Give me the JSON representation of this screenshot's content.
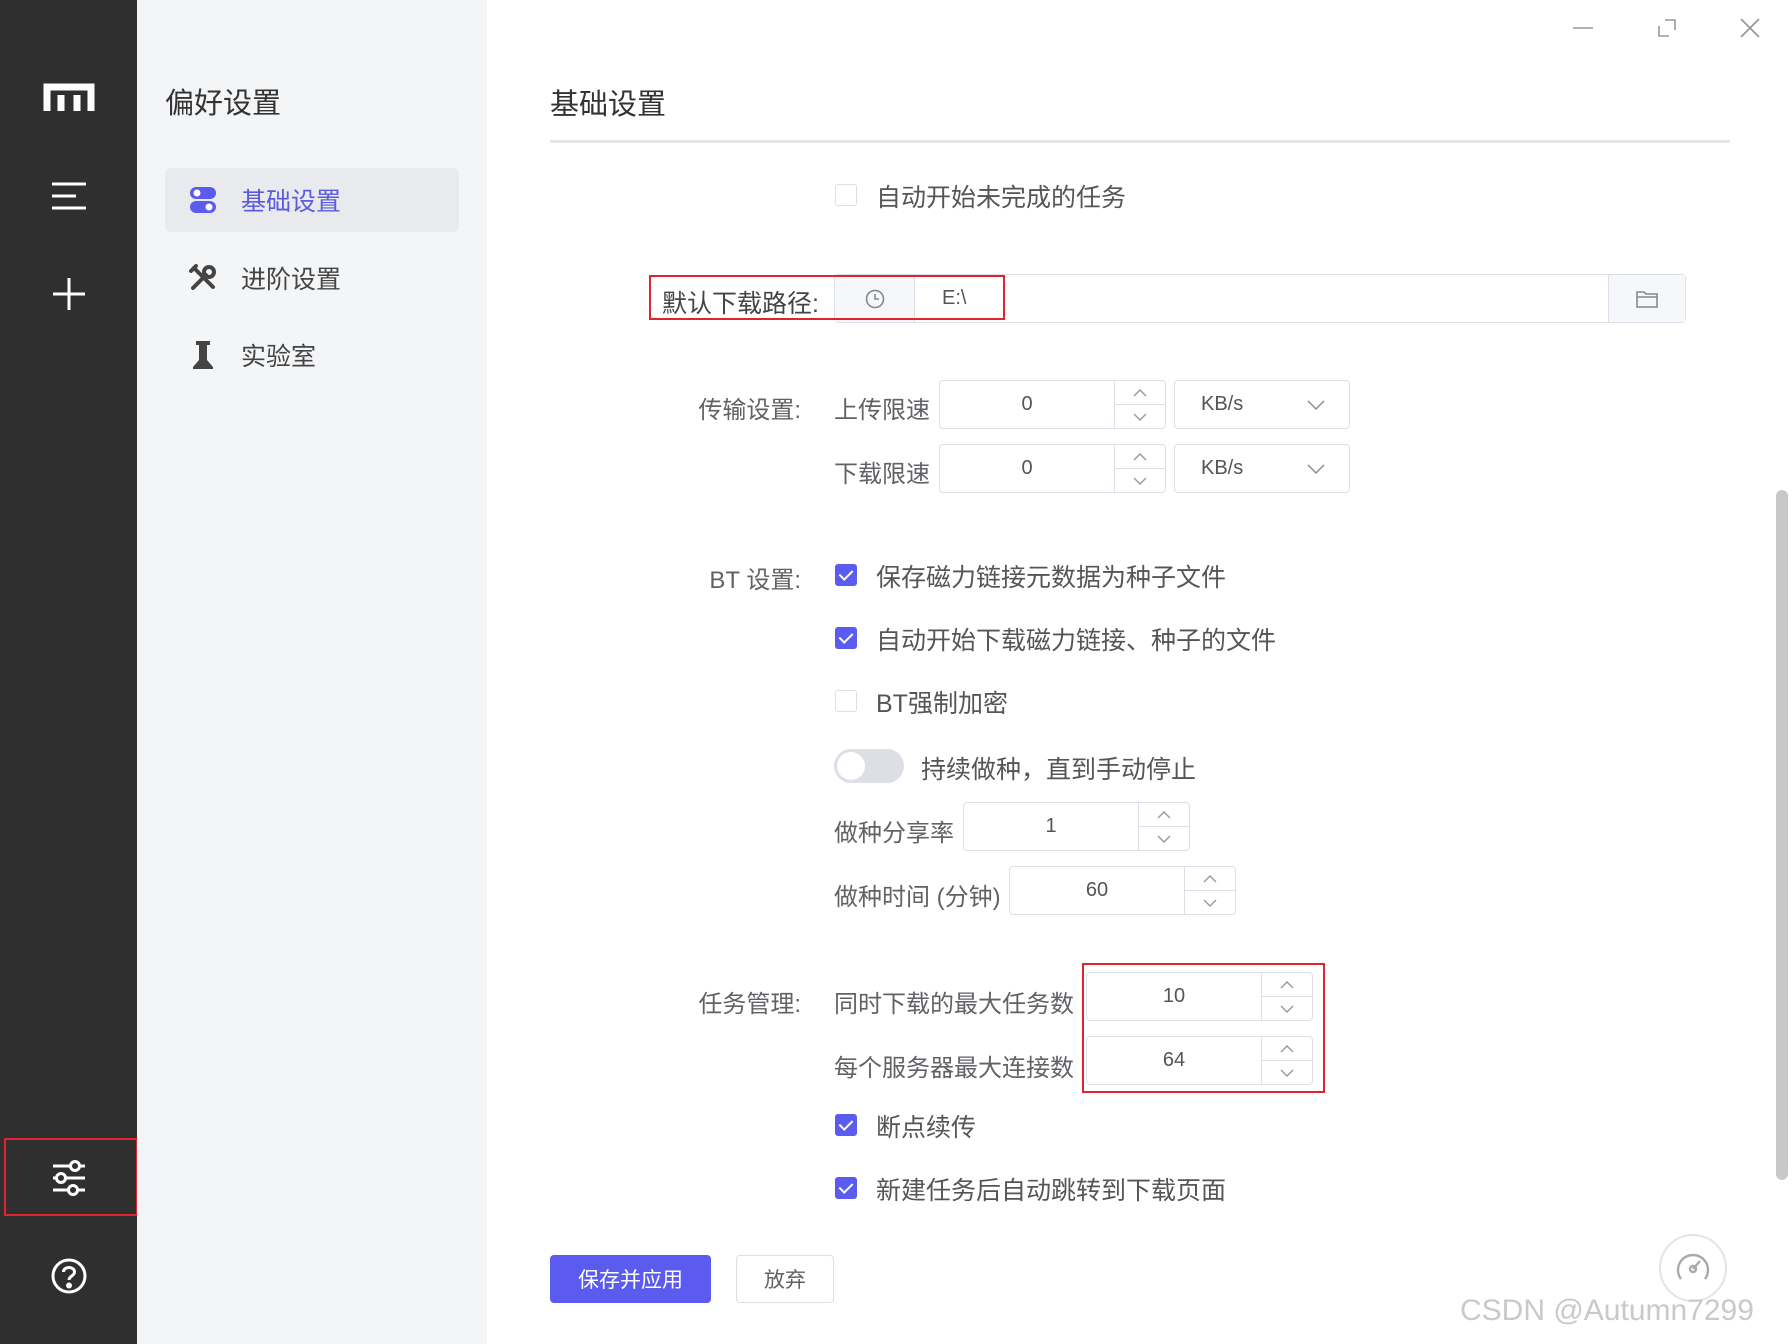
{
  "rail": {
    "items": [
      "logo-icon",
      "task-list-icon",
      "add-icon"
    ],
    "bottom": [
      "preferences-icon",
      "help-icon"
    ]
  },
  "sidebar": {
    "title": "偏好设置",
    "items": [
      {
        "label": "基础设置",
        "icon": "toggle-icon",
        "active": true
      },
      {
        "label": "进阶设置",
        "icon": "tools-icon",
        "active": false
      },
      {
        "label": "实验室",
        "icon": "flask-icon",
        "active": false
      }
    ]
  },
  "main": {
    "title": "基础设置",
    "auto_resume": {
      "label": "自动开始未完成的任务",
      "checked": false
    },
    "download_path": {
      "label": "默认下载路径:",
      "value": "E:\\"
    },
    "transfer": {
      "label": "传输设置:",
      "upload_label": "上传限速",
      "upload_value": "0",
      "upload_unit": "KB/s",
      "download_label": "下载限速",
      "download_value": "0",
      "download_unit": "KB/s"
    },
    "bt": {
      "label": "BT 设置:",
      "save_magnet": {
        "label": "保存磁力链接元数据为种子文件",
        "checked": true
      },
      "auto_start": {
        "label": "自动开始下载磁力链接、种子的文件",
        "checked": true
      },
      "force_encrypt": {
        "label": "BT强制加密",
        "checked": false
      },
      "keep_seeding": {
        "label": "持续做种，直到手动停止",
        "on": false
      },
      "seed_ratio_label": "做种分享率",
      "seed_ratio_value": "1",
      "seed_time_label": "做种时间 (分钟)",
      "seed_time_value": "60"
    },
    "task": {
      "label": "任务管理:",
      "max_concurrent_label": "同时下载的最大任务数",
      "max_concurrent_value": "10",
      "max_conn_label": "每个服务器最大连接数",
      "max_conn_value": "64",
      "resume": {
        "label": "断点续传",
        "checked": true
      },
      "jump": {
        "label": "新建任务后自动跳转到下载页面",
        "checked": true
      }
    },
    "save_button": "保存并应用",
    "discard_button": "放弃"
  },
  "colors": {
    "accent": "#5b5bef",
    "rail": "#2f2f2f",
    "sidebar": "#f4f5f7",
    "highlight": "#e0242f"
  },
  "watermark": "CSDN @Autumn7299"
}
